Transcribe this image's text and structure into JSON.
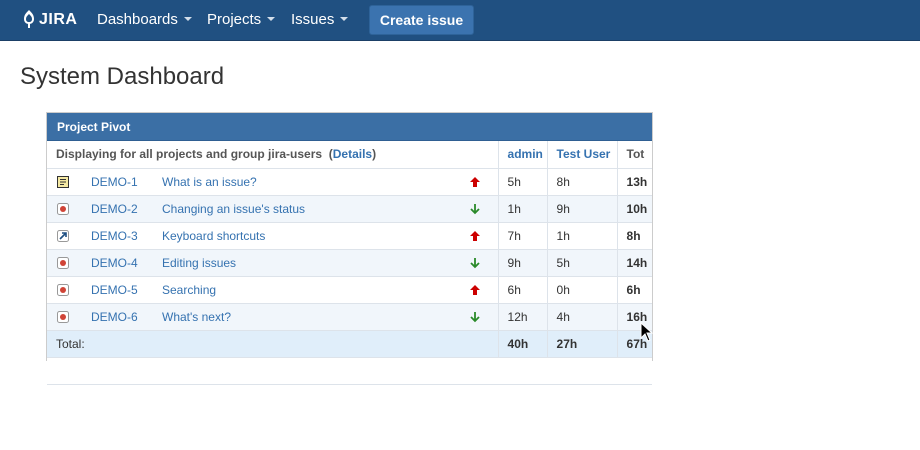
{
  "nav": {
    "logo_text": "JIRA",
    "items": [
      {
        "label": "Dashboards"
      },
      {
        "label": "Projects"
      },
      {
        "label": "Issues"
      }
    ],
    "create_label": "Create issue"
  },
  "page": {
    "title": "System Dashboard"
  },
  "gadget": {
    "title": "Project Pivot",
    "description_prefix": "Displaying for all projects and group jira-users",
    "details_link": "Details",
    "columns": [
      "admin",
      "Test User",
      "Tot"
    ],
    "rows": [
      {
        "key": "DEMO-1",
        "summary": "What is an issue?",
        "type_icon": "task-icon",
        "priority": "major-up-arrow-icon",
        "admin": "5h",
        "test_user": "8h",
        "total": "13h"
      },
      {
        "key": "DEMO-2",
        "summary": "Changing an issue's status",
        "type_icon": "bug-icon",
        "priority": "minor-down-arrow-icon",
        "admin": "1h",
        "test_user": "9h",
        "total": "10h"
      },
      {
        "key": "DEMO-3",
        "summary": "Keyboard shortcuts",
        "type_icon": "improvement-icon",
        "priority": "major-up-arrow-icon",
        "admin": "7h",
        "test_user": "1h",
        "total": "8h"
      },
      {
        "key": "DEMO-4",
        "summary": "Editing issues",
        "type_icon": "bug-icon",
        "priority": "minor-down-arrow-icon",
        "admin": "9h",
        "test_user": "5h",
        "total": "14h"
      },
      {
        "key": "DEMO-5",
        "summary": "Searching",
        "type_icon": "bug-icon",
        "priority": "major-up-arrow-icon",
        "admin": "6h",
        "test_user": "0h",
        "total": "6h"
      },
      {
        "key": "DEMO-6",
        "summary": "What's next?",
        "type_icon": "bug-icon",
        "priority": "minor-down-arrow-icon",
        "admin": "12h",
        "test_user": "4h",
        "total": "16h"
      }
    ],
    "total_row": {
      "label": "Total:",
      "admin": "40h",
      "test_user": "27h",
      "total": "67h"
    }
  },
  "colors": {
    "nav_bg": "#205081",
    "create_button": "#3b73af",
    "gadget_header": "#3b6fa5",
    "link": "#3572b0",
    "priority_up": "#cc0000",
    "priority_down": "#2a8a2a"
  }
}
